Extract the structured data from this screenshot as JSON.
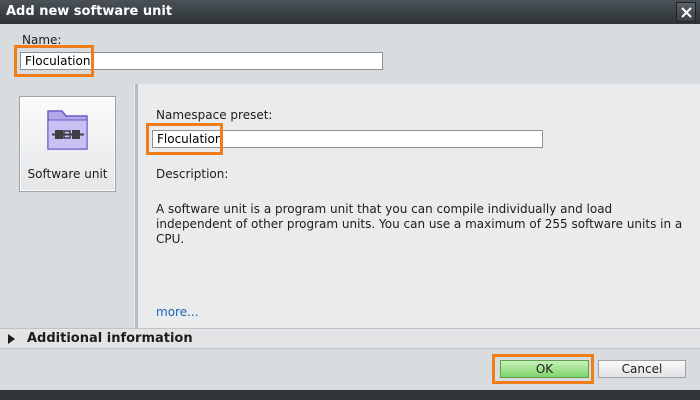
{
  "window": {
    "title": "Add new software unit"
  },
  "name": {
    "label": "Name:",
    "value": "Floculation"
  },
  "unit_types": [
    {
      "label": "Software unit",
      "icon": "software-unit-icon"
    }
  ],
  "details": {
    "namespace_label": "Namespace preset:",
    "namespace_value": "Floculation",
    "description_label": "Description:",
    "description_text": "A software unit is a program unit that you can compile individually and load independent of other program units. You can use a maximum of 255 software units in a CPU.",
    "more_link": "more..."
  },
  "additional_info": {
    "label": "Additional information"
  },
  "buttons": {
    "ok": "OK",
    "cancel": "Cancel"
  },
  "colors": {
    "highlight": "#f07d1a",
    "ok_button": "#7fd36a",
    "title_bar": "#2d3337",
    "link": "#1e63b8"
  }
}
